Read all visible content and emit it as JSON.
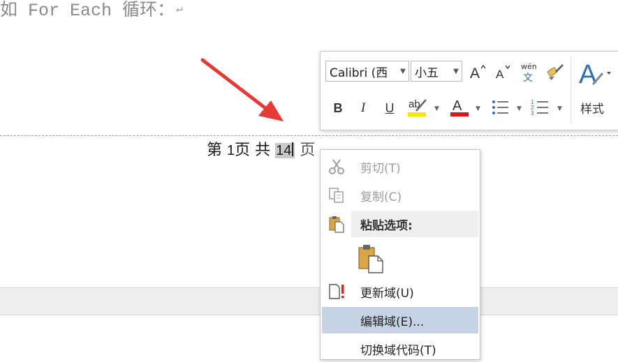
{
  "document": {
    "top_line": "如 For Each 循环：",
    "para_mark": "↵",
    "footer": {
      "prefix": "第",
      "current_page": "1",
      "middle": "页 共",
      "total_page": "14",
      "suffix": "页"
    }
  },
  "mini_toolbar": {
    "font_name": "Calibri (西",
    "font_size": "小五",
    "phonetic_label": "wén",
    "phonetic_char": "文",
    "bold_label": "B",
    "italic_label": "I",
    "underline_label": "U",
    "highlight_label": "ab",
    "font_color_label": "A",
    "styles_label": "样式",
    "colors": {
      "highlight": "#f6e600",
      "font_color": "#e0141e",
      "styles_accent": "#2e6fb7"
    }
  },
  "context_menu": {
    "items": [
      {
        "label": "剪切(T)",
        "icon": "scissors-icon",
        "enabled": false
      },
      {
        "label": "复制(C)",
        "icon": "copy-icon",
        "enabled": false
      },
      {
        "label": "粘贴选项:",
        "icon": "paste-icon",
        "enabled": true
      },
      {
        "label": "更新域(U)",
        "icon": "update-field-icon",
        "enabled": true
      },
      {
        "label": "编辑域(E)...",
        "icon": "",
        "enabled": true
      },
      {
        "label": "切换域代码(T)",
        "icon": "",
        "enabled": true
      }
    ],
    "hover_color": "#c5d3e5"
  },
  "annotation": {
    "arrow_color": "#e53a36"
  }
}
